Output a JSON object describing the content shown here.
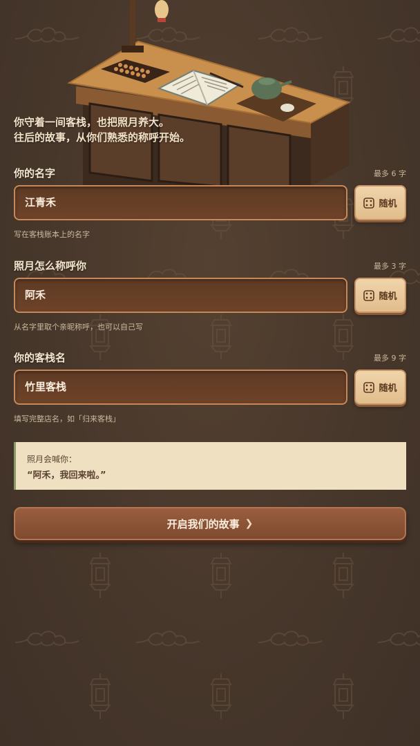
{
  "intro": {
    "line1": "你守着一间客栈，也把照月养大。",
    "line2": "往后的故事，从你们熟悉的称呼开始。"
  },
  "fields": [
    {
      "label": "你的名字",
      "limit": "最多 6 字",
      "value": "江青禾",
      "hint": "写在客栈账本上的名字",
      "random_label": "随机"
    },
    {
      "label": "照月怎么称呼你",
      "limit": "最多 3 字",
      "value": "阿禾",
      "hint": "从名字里取个亲昵称呼，也可以自己写",
      "random_label": "随机"
    },
    {
      "label": "你的客栈名",
      "limit": "最多 9 字",
      "value": "竹里客栈",
      "hint": "填写完整店名，如「归来客栈」",
      "random_label": "随机"
    }
  ],
  "preview": {
    "label": "照月会喊你：",
    "quote": "“阿禾，我回来啦。”"
  },
  "start_button": {
    "label": "开启我们的故事",
    "icon": "chevron-right-icon"
  },
  "colors": {
    "background": "#4b3a2d",
    "input_bg": "#663f26",
    "input_border": "#c8895a",
    "dice_button": "#ebcb9c",
    "preview_bg": "#efe0c2",
    "start_button": "#8c5436"
  }
}
